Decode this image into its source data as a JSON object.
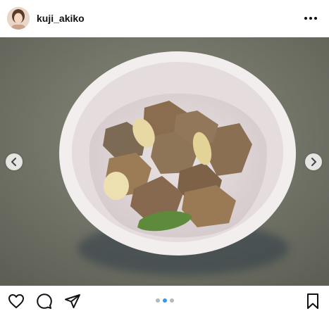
{
  "post": {
    "username": "kuji_akiko",
    "avatar_icon": "profile-avatar",
    "more_icon": "more-horizontal-icon",
    "carousel": {
      "total_slides": 3,
      "active_index": 1,
      "prev_icon": "chevron-left-icon",
      "next_icon": "chevron-right-icon"
    },
    "actions": {
      "like_icon": "heart-icon",
      "comment_icon": "comment-icon",
      "share_icon": "send-icon",
      "save_icon": "bookmark-icon"
    }
  },
  "colors": {
    "active_dot": "#3897f0",
    "inactive_dot": "#b8b8b8"
  }
}
